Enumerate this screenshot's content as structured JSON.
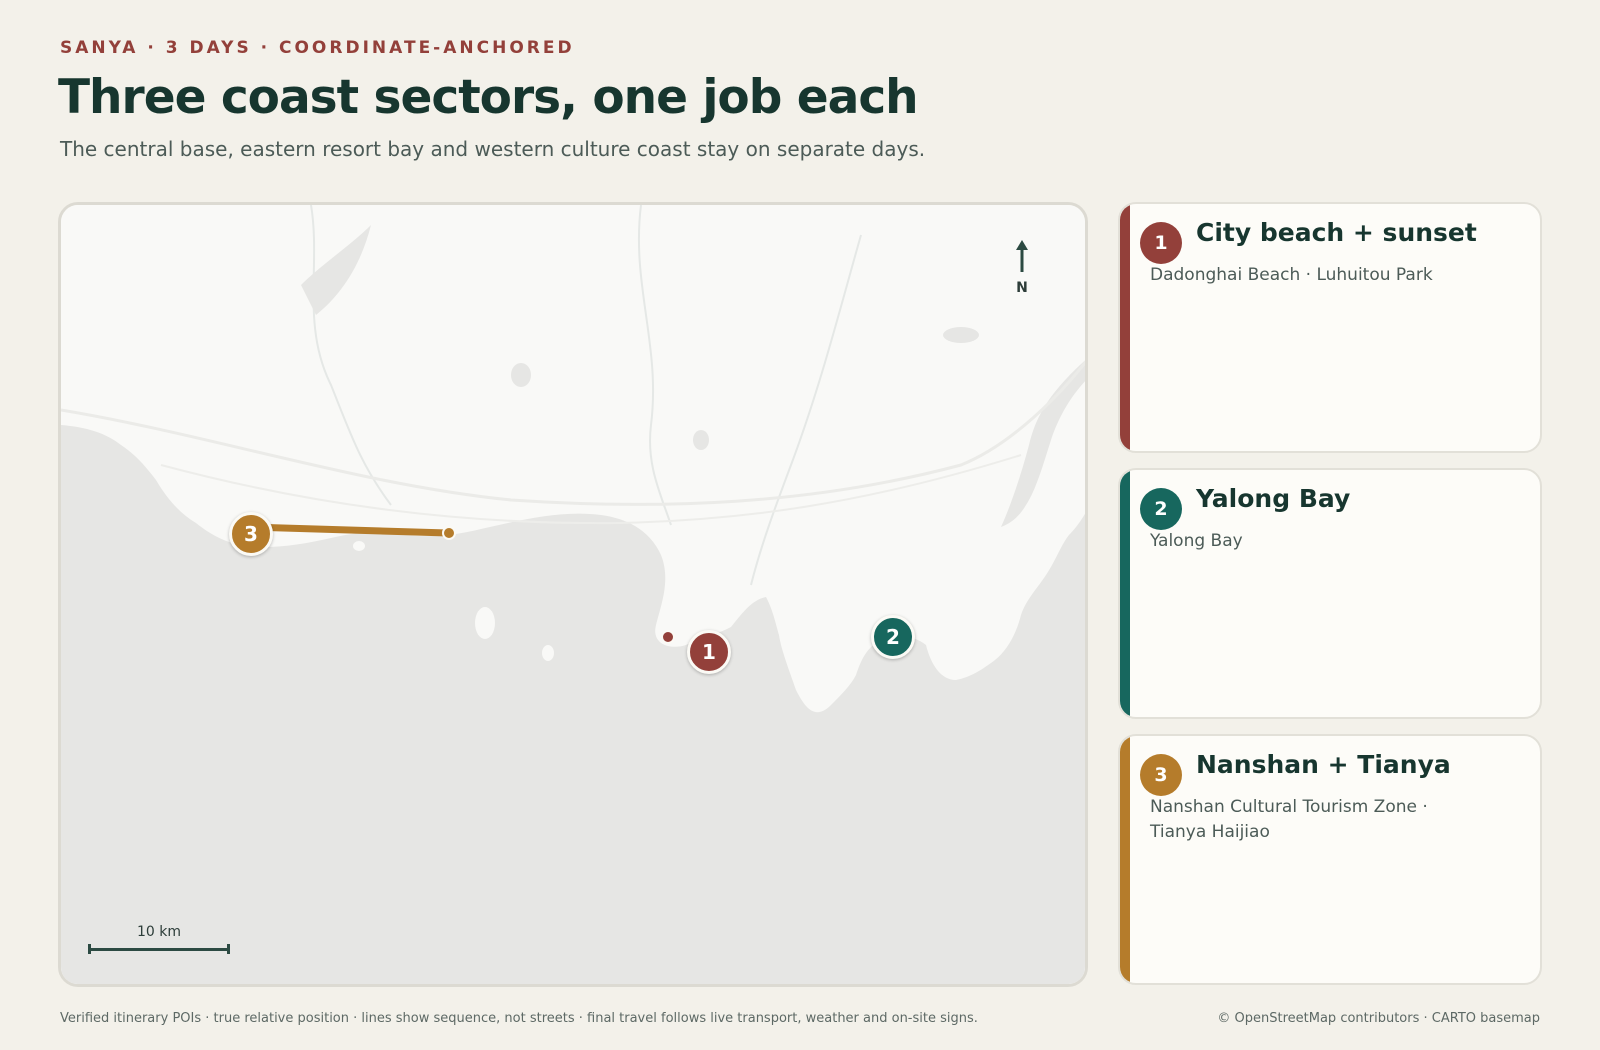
{
  "header": {
    "eyebrow": "SANYA · 3 DAYS · COORDINATE-ANCHORED",
    "title": "Three coast sectors, one job each",
    "subtitle": "The central base, eastern resort bay and western culture coast stay on separate days."
  },
  "map": {
    "north_label": "N",
    "scale_label": "10 km",
    "markers": [
      {
        "number": "1",
        "color": "#93403a"
      },
      {
        "number": "2",
        "color": "#17675e"
      },
      {
        "number": "3",
        "color": "#b57c2b"
      }
    ]
  },
  "days": [
    {
      "number": "1",
      "title": "City beach + sunset",
      "places": "Dadonghai Beach · Luhuitou Park",
      "color": "#93403a"
    },
    {
      "number": "2",
      "title": "Yalong Bay",
      "places": "Yalong Bay",
      "color": "#17675e"
    },
    {
      "number": "3",
      "title": "Nanshan + Tianya",
      "places": "Nanshan Cultural Tourism Zone · Tianya Haijiao",
      "color": "#b57c2b"
    }
  ],
  "footer": {
    "note": "Verified itinerary POIs · true relative position · lines show sequence, not streets · final travel follows live transport, weather and on-site signs.",
    "attribution": "© OpenStreetMap contributors · CARTO basemap"
  }
}
